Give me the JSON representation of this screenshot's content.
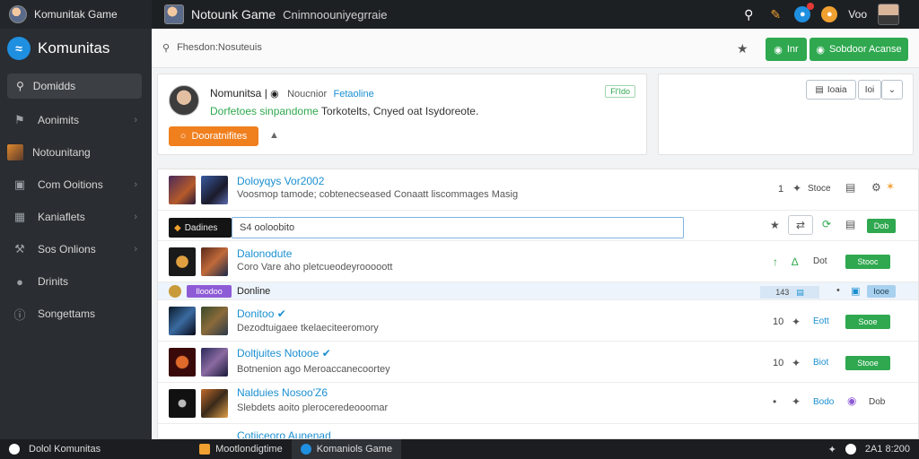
{
  "topbar": {
    "app_name": "Komunitak Game",
    "title": "Notounk Game",
    "subtitle": "Cnimnoouniyegrraie",
    "user_name": "Voo"
  },
  "sidebar": {
    "brand": "Komunitas",
    "search_label": "Domidds",
    "items": [
      {
        "label": "Aonimits",
        "icon": "people-icon"
      },
      {
        "label": "Notounitang",
        "icon": "game-thumb-icon"
      },
      {
        "label": "Com Ooitions",
        "icon": "monitor-icon"
      },
      {
        "label": "Kaniaflets",
        "icon": "grid-icon"
      },
      {
        "label": "Sos Onlions",
        "icon": "wrench-icon"
      },
      {
        "label": "Drinits",
        "icon": "person-icon"
      },
      {
        "label": "Songettams",
        "icon": "info-icon"
      }
    ]
  },
  "searchbar": {
    "placeholder": "Fhesdon:Nosuteuis",
    "btn_small": "Inr",
    "btn_wide": "Sobdoor Acanse"
  },
  "profile": {
    "name": "Nomunitsa |",
    "sub": "Noucnior",
    "status": "Fetaoline",
    "desc_green": "Dorfetoes sinpandome",
    "desc_rest": "Torkotelts,  Cnyed oat Isydoreote.",
    "tag": "Fl'Ido",
    "action_label": "Dooratnifites"
  },
  "side_card": {
    "btn1": "Ioaia",
    "btn2": "Ioi"
  },
  "list": {
    "row1": {
      "title": "Doloyqys Vor2002",
      "desc": "Voosmop tamode; cobtenecseased Conaatt liscommages Masig",
      "count": "1",
      "label": "Stoce"
    },
    "input_row": {
      "tag": "Dadines",
      "value": "S4  ooloobito",
      "btn": "Dob"
    },
    "row2": {
      "title": "Dalonodute",
      "desc": "Coro Vare aho pletcueodeyrooooott",
      "label": "Dot",
      "btn": "Stooc"
    },
    "sep_row": {
      "tag": "Iloodoo",
      "title": "Donline",
      "count": "143",
      "btn": "Iooe"
    },
    "row3": {
      "title": "Donitoo",
      "desc": "Dezodtuigaee tkelaeciteeromory",
      "count": "10",
      "label": "Eott",
      "btn": "Sooe"
    },
    "row4": {
      "title": "Doltjuites Notooe",
      "desc": "Botnenion ago  Meroaccanecoortey",
      "count": "10",
      "label": "Biot",
      "btn": "Stooe"
    },
    "row5": {
      "title": "Nalduies Nosoo'Z6",
      "desc": "Slebdets aoito pleroceredeooomar",
      "label": "Bodo",
      "btn": "Dob"
    },
    "row6": {
      "title": "Cotiiceoro  Aunenad"
    }
  },
  "taskbar": {
    "start_label": "Dolol Komunitas",
    "item2": "Mootlondigtime",
    "item3": "Komaniols Game",
    "clock": "2A1 8:200"
  },
  "colors": {
    "accent_blue": "#1a8fd0",
    "green": "#2fa84f",
    "orange": "#f07f1e",
    "purple": "#8e5bd6"
  }
}
